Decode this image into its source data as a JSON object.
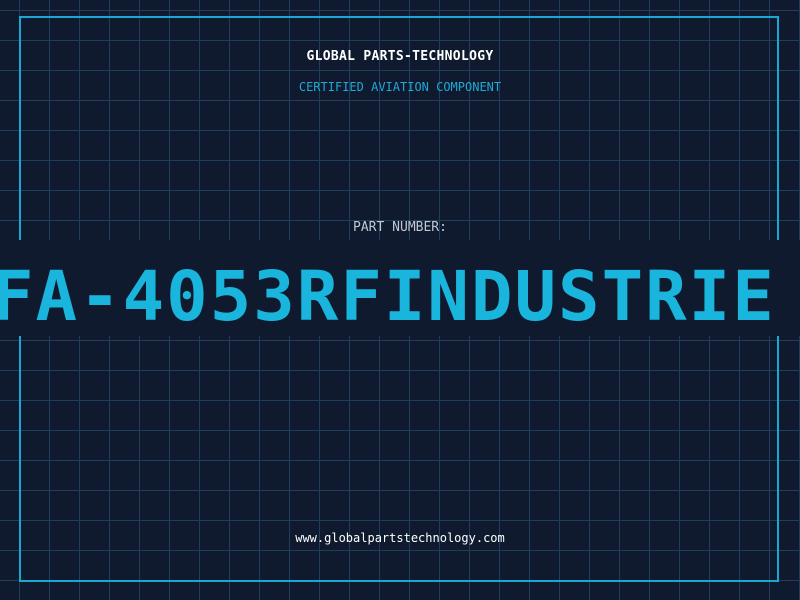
{
  "card": {
    "company_name": "GLOBAL PARTS-TECHNOLOGY",
    "subtitle": "CERTIFIED AVIATION COMPONENT",
    "part_label": "PART NUMBER:",
    "part_number": "FA-4053RFINDUSTRIE",
    "website": "www.globalpartstechnology.com"
  },
  "colors": {
    "background": "#0f1a2e",
    "grid": "#1f3f5c",
    "frame": "#1aa7d2",
    "accent": "#1ab5dc",
    "text_primary": "#ffffff",
    "text_muted": "#c0c8d4"
  }
}
